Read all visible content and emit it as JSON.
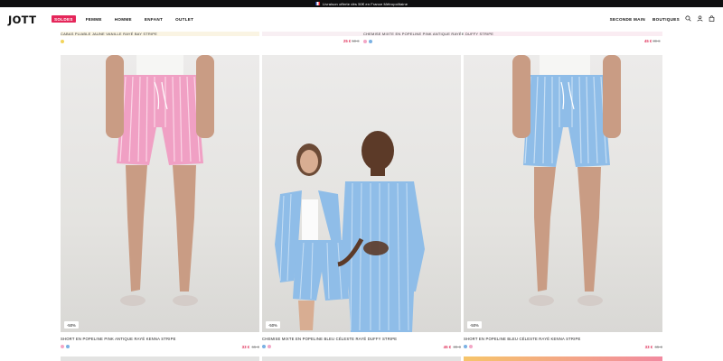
{
  "promo": {
    "text": "Livraison offerte dès 50€ en France Métropolitaine"
  },
  "header": {
    "logo": "JOTT",
    "nav": [
      "SOLDES",
      "FEMME",
      "HOMME",
      "ENFANT",
      "OUTLET"
    ],
    "right_nav": [
      "SECONDE MAIN",
      "BOUTIQUES"
    ],
    "icons": [
      "search-icon",
      "account-icon",
      "bag-icon"
    ]
  },
  "above_row": {
    "left_title": "CABAS PLIABLE JAUNE VANILLE RAYÉ BAY STRIPE",
    "center_price": {
      "now": "25 €",
      "old": "50 €"
    },
    "right_title": "CHEMISE MIXTE EN POPELINE PINK ANTIQUE RAYÉE DUFFY STRIPE",
    "right_price": {
      "now": "45 €",
      "old": "89 €"
    }
  },
  "products": [
    {
      "title": "SHORT EN POPELINE PINK ANTIQUE RAYÉ KENNA STRIPE",
      "discount": "-50%",
      "price_now": "33 €",
      "price_old": "65 €",
      "swatches": [
        "#f3a7c6",
        "#7ab1e3"
      ]
    },
    {
      "title": "CHEMISE MIXTE EN POPELINE BLEU CÉLESTE RAYÉ DUFFY STRIPE",
      "discount": "-50%",
      "price_now": "45 €",
      "price_old": "89 €",
      "swatches": [
        "#7ab1e3",
        "#f3a7c6"
      ]
    },
    {
      "title": "SHORT EN POPELINE BLEU CÉLESTE RAYÉ KENNA STRIPE",
      "discount": "-50%",
      "price_now": "33 €",
      "price_old": "65 €",
      "swatches": [
        "#7ab1e3",
        "#f3a7c6"
      ]
    }
  ],
  "colors": {
    "accent": "#e5265a",
    "price": "#e0305a",
    "pink_short": "#f0a0c4",
    "blue_shirt": "#8fbde8"
  }
}
